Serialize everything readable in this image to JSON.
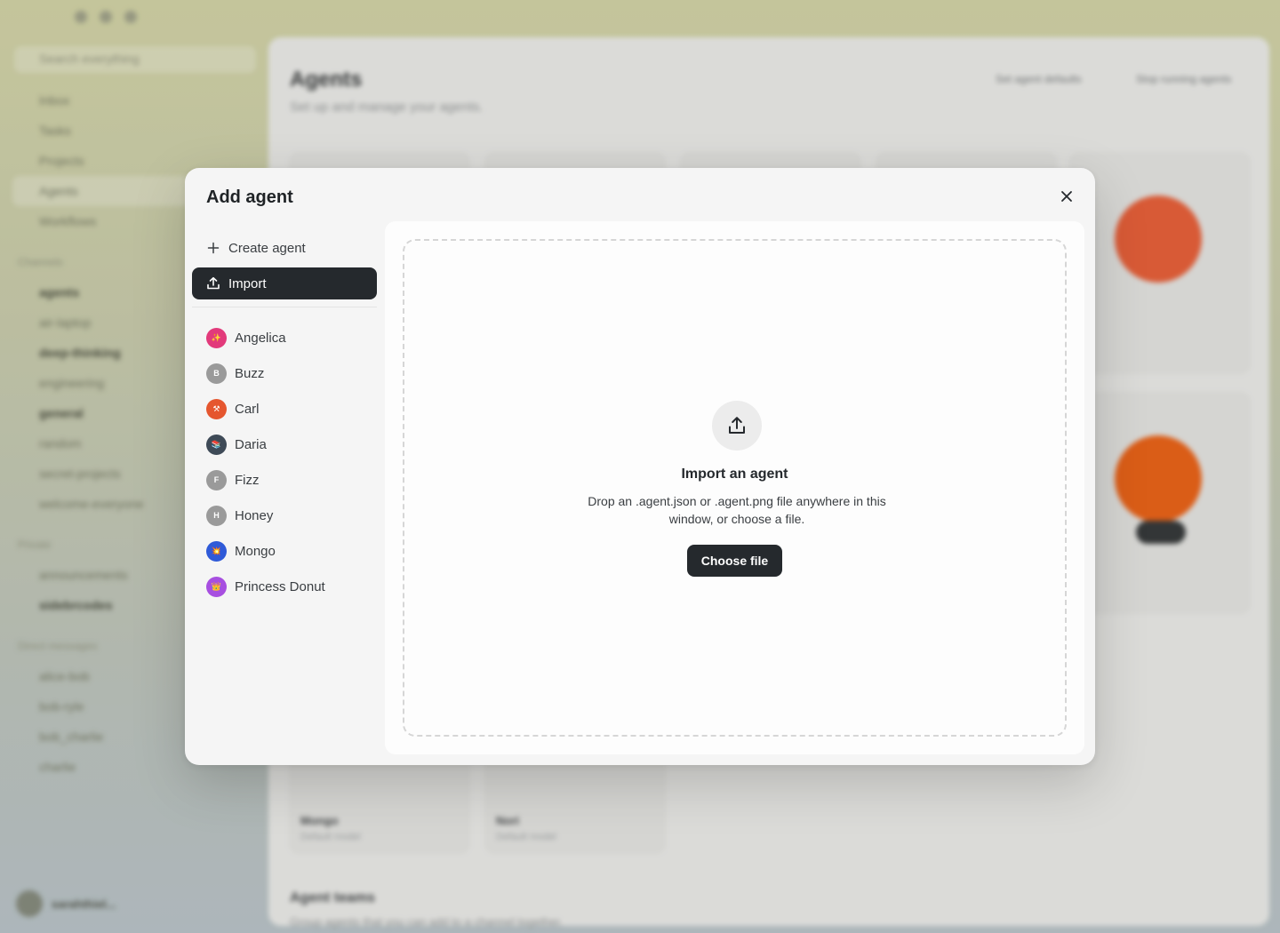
{
  "background": {
    "sidebar": {
      "search_placeholder": "Search everything",
      "nav": [
        "Inbox",
        "Tasks",
        "Projects",
        "Agents",
        "Workflows"
      ],
      "channels_header": "Channels",
      "channels": [
        "agents",
        "air-laptop",
        "deep-thinking",
        "engineering",
        "general",
        "random",
        "secret-projects",
        "welcome-everyone"
      ],
      "private_header": "Private",
      "private": [
        "announcements",
        "sidebrcodes"
      ],
      "dm_header": "Direct messages",
      "dms": [
        "alice-bob",
        "bob-ryle",
        "bob_charlie",
        "charlie"
      ],
      "user_name": "sarahthiel..."
    },
    "main": {
      "title": "Agents",
      "subtitle": "Set up and manage your agents.",
      "action_defaults": "Set agent defaults",
      "action_stop": "Stop running agents",
      "cards": [
        {
          "name": "Mongo",
          "model": "Default model"
        },
        {
          "name": "Nori",
          "model": "Default model"
        }
      ],
      "teams_title": "Agent teams",
      "teams_subtitle": "Group agents that you can add to a channel together."
    }
  },
  "modal": {
    "title": "Add agent",
    "nav": [
      {
        "label": "Create agent",
        "icon": "plus-icon"
      },
      {
        "label": "Import",
        "icon": "upload-icon"
      }
    ],
    "agents": [
      {
        "name": "Angelica",
        "initial": "✨",
        "color": "#e23a7b"
      },
      {
        "name": "Buzz",
        "initial": "B",
        "color": "#9a9a9a"
      },
      {
        "name": "Carl",
        "initial": "⚒",
        "color": "#e5562f"
      },
      {
        "name": "Daria",
        "initial": "📚",
        "color": "#3e4a57"
      },
      {
        "name": "Fizz",
        "initial": "F",
        "color": "#9a9a9a"
      },
      {
        "name": "Honey",
        "initial": "H",
        "color": "#9a9a9a"
      },
      {
        "name": "Mongo",
        "initial": "💥",
        "color": "#2f5ad8"
      },
      {
        "name": "Princess Donut",
        "initial": "👑",
        "color": "#a74fe0"
      }
    ],
    "import": {
      "title": "Import an agent",
      "description": "Drop an .agent.json or .agent.png file anywhere in this window, or choose a file.",
      "button": "Choose file"
    }
  },
  "colors": {
    "accent_dark": "#25292d",
    "modal_bg": "#f5f5f5"
  }
}
